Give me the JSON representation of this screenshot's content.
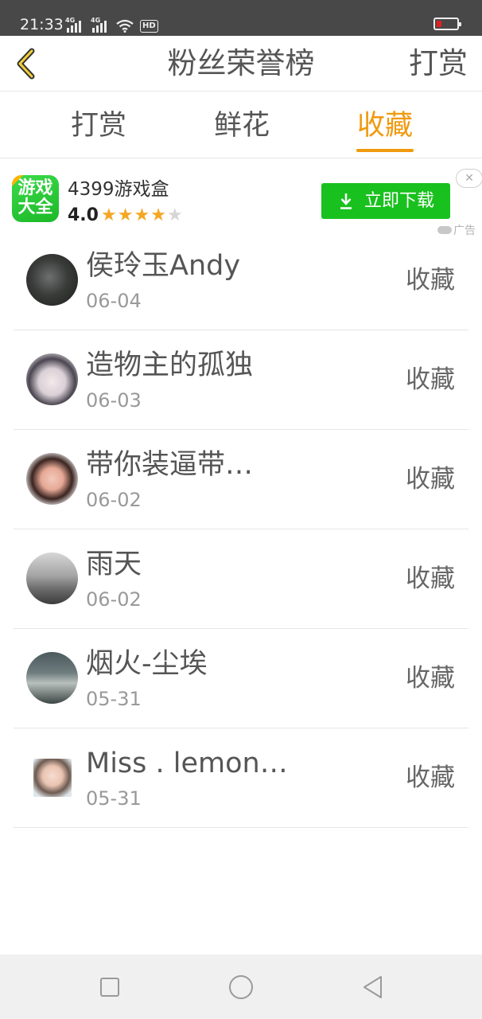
{
  "status_bar": {
    "time": "21:33",
    "network_1": "4G",
    "network_2": "4G",
    "hd_label": "HD",
    "battery_color": "#e02020"
  },
  "header": {
    "back_icon": "chevron-left-icon",
    "title": "粉丝荣誉榜",
    "action": "打赏"
  },
  "tabs": {
    "items": [
      {
        "label": "打赏"
      },
      {
        "label": "鲜花"
      },
      {
        "label": "收藏"
      }
    ],
    "active_index": 2,
    "active_color": "#f09a0e"
  },
  "ad": {
    "app_icon_text_line1": "游戏",
    "app_icon_text_line2": "大全",
    "app_name": "4399游戏盒",
    "rating": "4.0",
    "stars_filled": 4,
    "stars_total": 5,
    "download_label": "立即下载",
    "download_color": "#19c11e",
    "ad_label": "广告",
    "close_icon": "close-icon"
  },
  "fans": [
    {
      "name": "侯玲玉Andy",
      "date": "06-04",
      "action": "收藏"
    },
    {
      "name": "造物主的孤独",
      "date": "06-03",
      "action": "收藏"
    },
    {
      "name": "带你装逼带…",
      "date": "06-02",
      "action": "收藏"
    },
    {
      "name": "雨天",
      "date": "06-02",
      "action": "收藏"
    },
    {
      "name": "烟火-尘埃",
      "date": "05-31",
      "action": "收藏"
    },
    {
      "name": "Miss . lemon…",
      "date": "05-31",
      "action": "收藏"
    }
  ],
  "nav_bar": {
    "recent_icon": "square-icon",
    "home_icon": "circle-icon",
    "back_icon": "triangle-back-icon"
  }
}
